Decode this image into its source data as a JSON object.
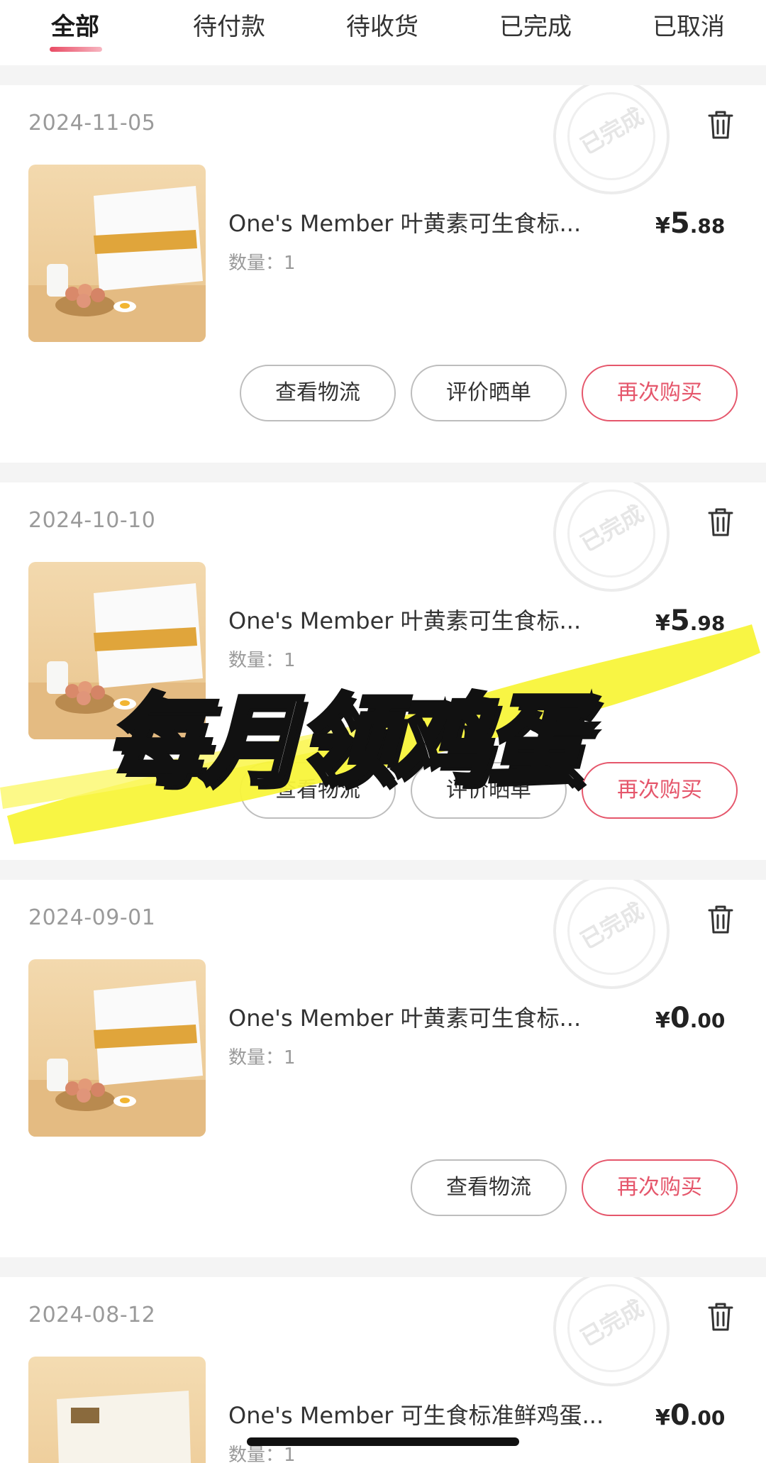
{
  "tabs": [
    "全部",
    "待付款",
    "待收货",
    "已完成",
    "已取消"
  ],
  "stamp_text": "已完成",
  "orders": [
    {
      "date": "2024-11-05",
      "title": "One's Member 叶黄素可生食标...",
      "qty": "数量：1",
      "price": {
        "symbol": "¥",
        "int": "5",
        "dec": ".88"
      },
      "buttons": [
        "查看物流",
        "评价晒单",
        "再次购买"
      ]
    },
    {
      "date": "2024-10-10",
      "title": "One's Member 叶黄素可生食标...",
      "qty": "数量：1",
      "price": {
        "symbol": "¥",
        "int": "5",
        "dec": ".98"
      },
      "buttons": [
        "查看物流",
        "评价晒单",
        "再次购买"
      ]
    },
    {
      "date": "2024-09-01",
      "title": "One's Member 叶黄素可生食标...",
      "qty": "数量：1",
      "price": {
        "symbol": "¥",
        "int": "0",
        "dec": ".00"
      },
      "buttons": [
        "查看物流",
        "再次购买"
      ]
    },
    {
      "date": "2024-08-12",
      "title": "One's Member 可生食标准鲜鸡蛋...",
      "qty": "数量：1",
      "price": {
        "symbol": "¥",
        "int": "0",
        "dec": ".00"
      },
      "buttons": []
    }
  ],
  "overlay_text": "每月领鸡蛋",
  "colors": {
    "accent": "#e5566b",
    "highlight": "#f7f33a"
  }
}
